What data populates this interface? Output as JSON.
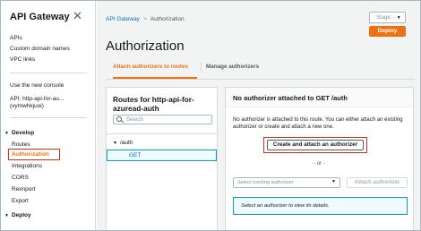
{
  "sidebar": {
    "title": "API Gateway",
    "close_icon": "close-icon",
    "top_links": [
      "APIs",
      "Custom domain names",
      "VPC links"
    ],
    "console_link": "Use the new console",
    "api_label": "API: http-api-for-au...",
    "api_id": "(vymwhkjuoi)",
    "develop_group": "Develop",
    "develop_items": [
      "Routes",
      "Authorization",
      "Integrations",
      "CORS",
      "Reimport",
      "Export"
    ],
    "deploy_group": "Deploy"
  },
  "breadcrumb": {
    "first": "API Gateway",
    "separator": ">",
    "current": "Authorization"
  },
  "header": {
    "stage_placeholder": "Stage: -",
    "deploy_label": "Deploy",
    "title": "Authorization"
  },
  "tabs": [
    "Attach authorizers to routes",
    "Manage authorizers"
  ],
  "routes_panel": {
    "title_line1": "Routes for http-api-for-",
    "title_line2": "azuread-auth",
    "search_placeholder": "Search",
    "route_path": "/auth",
    "route_method": "GET"
  },
  "auth_panel": {
    "title": "No authorizer attached to GET /auth",
    "description": "No authorizer is attached to this route. You can either attach an existing authorizer or create and attach a new one.",
    "create_button": "Create and attach an authorizer",
    "or_text": "- or -",
    "select_placeholder": "Select existing authorizer",
    "attach_button": "Attach authorizer",
    "info_text": "Select an authorizer to view its details."
  },
  "colors": {
    "accent": "#ec7211",
    "link": "#0073bb",
    "highlight": "#d13212"
  }
}
